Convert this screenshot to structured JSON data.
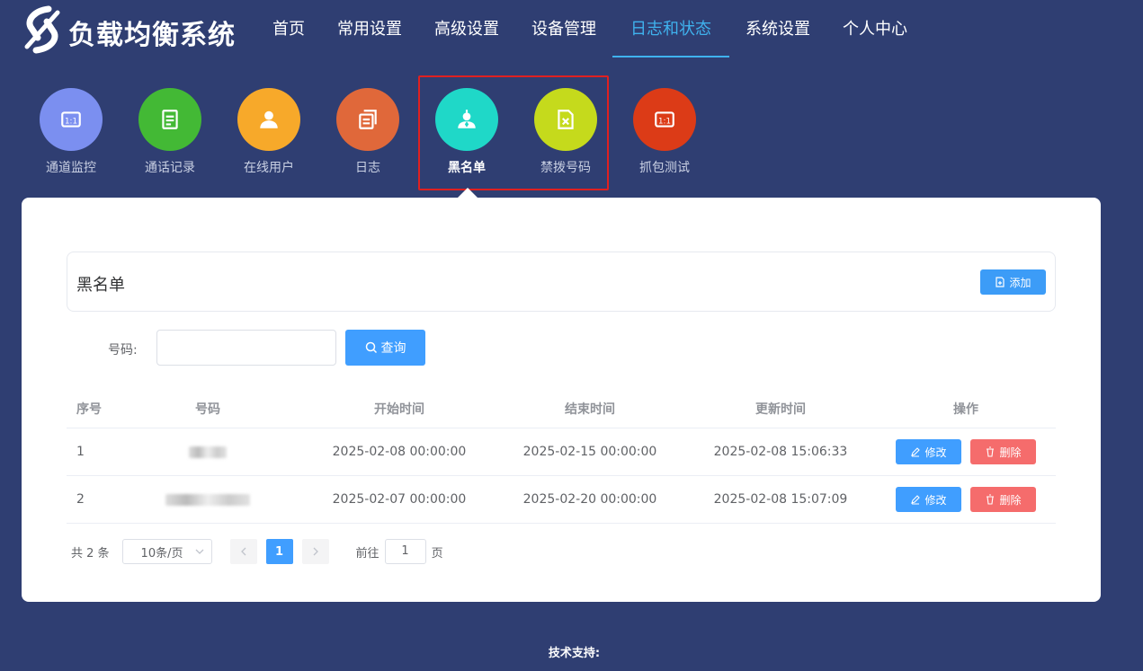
{
  "app": {
    "title": "负载均衡系统",
    "logo_icon": "link-logo-icon"
  },
  "nav": {
    "items": [
      {
        "label": "首页"
      },
      {
        "label": "常用设置"
      },
      {
        "label": "高级设置"
      },
      {
        "label": "设备管理"
      },
      {
        "label": "日志和状态",
        "active": true
      },
      {
        "label": "系统设置"
      },
      {
        "label": "个人中心"
      }
    ],
    "accent_color": "#3fb2ee"
  },
  "modules": [
    {
      "label": "通道监控",
      "icon": "monitor-icon",
      "color": "#7b8ff0"
    },
    {
      "label": "通话记录",
      "icon": "document-icon",
      "color": "#43b935"
    },
    {
      "label": "在线用户",
      "icon": "user-icon",
      "color": "#f7a92a"
    },
    {
      "label": "日志",
      "icon": "files-icon",
      "color": "#e0683a"
    },
    {
      "label": "黑名单",
      "icon": "blacklist-user-icon",
      "color": "#1fd8c8",
      "active": true
    },
    {
      "label": "禁拨号码",
      "icon": "forbidden-file-icon",
      "color": "#c5da1c"
    },
    {
      "label": "抓包测试",
      "icon": "capture-icon",
      "color": "#dc3b17"
    }
  ],
  "panel": {
    "title": "黑名单",
    "add_button": "添加"
  },
  "search": {
    "label": "号码:",
    "value": "",
    "placeholder": "",
    "button": "查询"
  },
  "table": {
    "headers": [
      "序号",
      "号码",
      "开始时间",
      "结束时间",
      "更新时间",
      "操作"
    ],
    "rows": [
      {
        "index": "1",
        "number": "",
        "start": "2025-02-08 00:00:00",
        "end": "2025-02-15 00:00:00",
        "updated": "2025-02-08 15:06:33"
      },
      {
        "index": "2",
        "number": "",
        "start": "2025-02-07 00:00:00",
        "end": "2025-02-20 00:00:00",
        "updated": "2025-02-08 15:07:09"
      }
    ],
    "edit_label": "修改",
    "delete_label": "删除"
  },
  "pagination": {
    "total": "共 2 条",
    "page_size": "10条/页",
    "current_page": "1",
    "goto_prefix": "前往",
    "goto_value": "1",
    "goto_suffix": "页"
  },
  "footer": {
    "text": "技术支持:"
  }
}
